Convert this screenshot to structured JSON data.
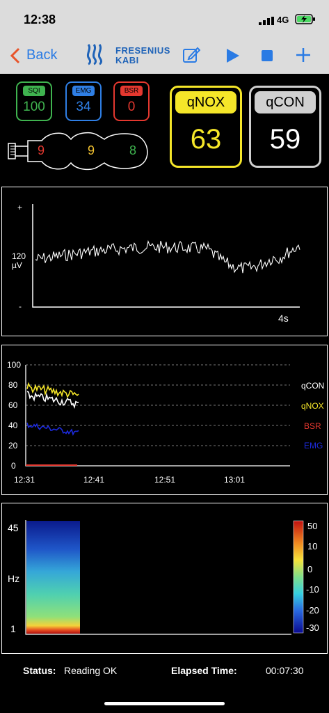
{
  "status_bar": {
    "time": "12:38",
    "network": "4G"
  },
  "nav": {
    "back_label": "Back",
    "brand_line1": "FRESENIUS",
    "brand_line2": "KABI"
  },
  "indicators": {
    "sqi": {
      "label": "SQI",
      "value": "100",
      "color": "#3fb34f"
    },
    "emg": {
      "label": "EMG",
      "value": "34",
      "color": "#2f7fe5"
    },
    "bsr": {
      "label": "BSR",
      "value": "0",
      "color": "#e5382f"
    }
  },
  "electrodes": {
    "values": [
      "9",
      "9",
      "8"
    ],
    "colors": [
      "#e5382f",
      "#f2c230",
      "#3fb34f"
    ]
  },
  "qnox": {
    "label": "qNOX",
    "value": "63",
    "color": "#f5e629"
  },
  "qcon": {
    "label": "qCON",
    "value": "59",
    "color": "#d0d0d0"
  },
  "eeg": {
    "plus": "+",
    "minus": "-",
    "scale_value": "120",
    "scale_unit": "µV",
    "time_label": "4s"
  },
  "trend": {
    "y_ticks": [
      "100",
      "80",
      "60",
      "40",
      "20",
      "0"
    ],
    "x_ticks": [
      "12:31",
      "12:41",
      "12:51",
      "13:01"
    ],
    "legend": [
      {
        "name": "qCON",
        "color": "#ffffff"
      },
      {
        "name": "qNOX",
        "color": "#f5e629"
      },
      {
        "name": "BSR",
        "color": "#e5382f"
      },
      {
        "name": "EMG",
        "color": "#1d2be0"
      }
    ]
  },
  "spectrum": {
    "y_top": "45",
    "y_unit": "Hz",
    "y_bottom": "1",
    "colorbar_ticks": [
      "50",
      "10",
      "0",
      "-10",
      "-20",
      "-30"
    ]
  },
  "footer": {
    "status_label": "Status:",
    "status_value": "Reading OK",
    "elapsed_label": "Elapsed Time:",
    "elapsed_value": "00:07:30"
  }
}
